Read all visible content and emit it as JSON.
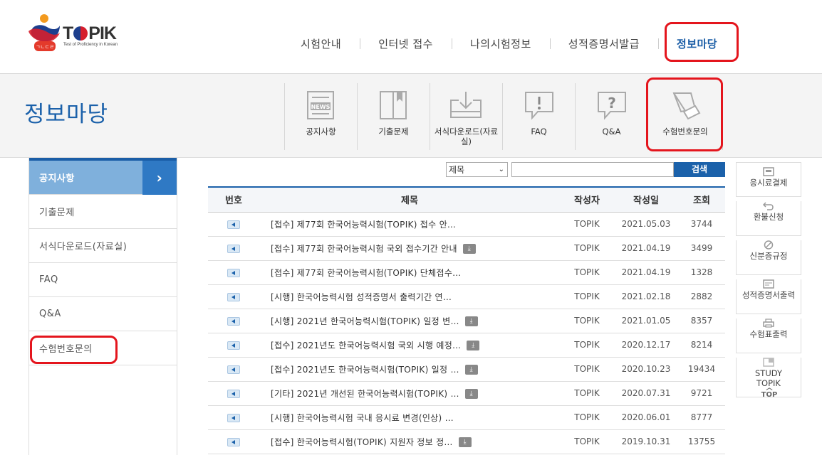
{
  "logo": {
    "wordmark": "TOPIK",
    "tagline": "Test of Proficiency in Korean"
  },
  "gnb": [
    {
      "label": "시험안내"
    },
    {
      "label": "인터넷 접수"
    },
    {
      "label": "나의시험정보"
    },
    {
      "label": "성적증명서발급"
    },
    {
      "label": "정보마당"
    }
  ],
  "section_title": "정보마당",
  "quick_menu": [
    {
      "label": "공지사항",
      "icon": "news-icon"
    },
    {
      "label": "기출문제",
      "icon": "book-icon"
    },
    {
      "label": "서식다운로드(자료실)",
      "icon": "download-icon"
    },
    {
      "label": "FAQ",
      "icon": "faq-icon"
    },
    {
      "label": "Q&A",
      "icon": "qna-icon"
    },
    {
      "label": "수험번호문의",
      "icon": "ticket-icon"
    }
  ],
  "lnb": [
    {
      "label": "공지사항"
    },
    {
      "label": "기출문제"
    },
    {
      "label": "서식다운로드(자료실)"
    },
    {
      "label": "FAQ"
    },
    {
      "label": "Q&A"
    },
    {
      "label": "수험번호문의"
    }
  ],
  "search": {
    "select_value": "제목",
    "input_value": "",
    "button_label": "검색"
  },
  "table": {
    "headers": [
      "번호",
      "제목",
      "작성자",
      "작성일",
      "조회"
    ],
    "rows": [
      {
        "title": "[접수] 제77회 한국어능력시험(TOPIK) 접수 안…",
        "author": "TOPIK",
        "date": "2021.05.03",
        "views": "3744",
        "file": false
      },
      {
        "title": "[접수] 제77회 한국어능력시험 국외 접수기간 안내",
        "author": "TOPIK",
        "date": "2021.04.19",
        "views": "3499",
        "file": true
      },
      {
        "title": "[접수] 제77회 한국어능력시험(TOPIK) 단체접수…",
        "author": "TOPIK",
        "date": "2021.04.19",
        "views": "1328",
        "file": false
      },
      {
        "title": "[시행] 한국어능력시험 성적증명서 출력기간 연…",
        "author": "TOPIK",
        "date": "2021.02.18",
        "views": "2882",
        "file": false
      },
      {
        "title": "[시행] 2021년 한국어능력시험(TOPIK) 일정 변…",
        "author": "TOPIK",
        "date": "2021.01.05",
        "views": "8357",
        "file": true
      },
      {
        "title": "[접수] 2021년도 한국어능력시험 국외 시행 예정…",
        "author": "TOPIK",
        "date": "2020.12.17",
        "views": "8214",
        "file": true
      },
      {
        "title": "[접수] 2021년도 한국어능력시험(TOPIK) 일정 …",
        "author": "TOPIK",
        "date": "2020.10.23",
        "views": "19434",
        "file": true
      },
      {
        "title": "[기타] 2021년 개선된 한국어능력시험(TOPIK) …",
        "author": "TOPIK",
        "date": "2020.07.31",
        "views": "9721",
        "file": true
      },
      {
        "title": "[시행] 한국어능력시험 국내 응시료 변경(인상) …",
        "author": "TOPIK",
        "date": "2020.06.01",
        "views": "8777",
        "file": false
      },
      {
        "title": "[접수] 한국어능력시험(TOPIK) 지원자 정보 정…",
        "author": "TOPIK",
        "date": "2019.10.31",
        "views": "13755",
        "file": true
      }
    ]
  },
  "right_bar": [
    {
      "label": "응시료결제",
      "icon": "card-icon"
    },
    {
      "label": "환불신청",
      "icon": "return-icon"
    },
    {
      "label": "신분증규정",
      "icon": "prohibit-icon"
    },
    {
      "label": "성적증명서출력",
      "icon": "certificate-icon"
    },
    {
      "label": "수험표출력",
      "icon": "printer-icon"
    },
    {
      "label": "STUDY TOPIK",
      "icon": "study-icon"
    }
  ],
  "top_label": "TOP",
  "colors": {
    "brand_blue": "#1b61aa",
    "highlight_red": "#e4151d",
    "lnb_active": "#7fb0dc"
  }
}
